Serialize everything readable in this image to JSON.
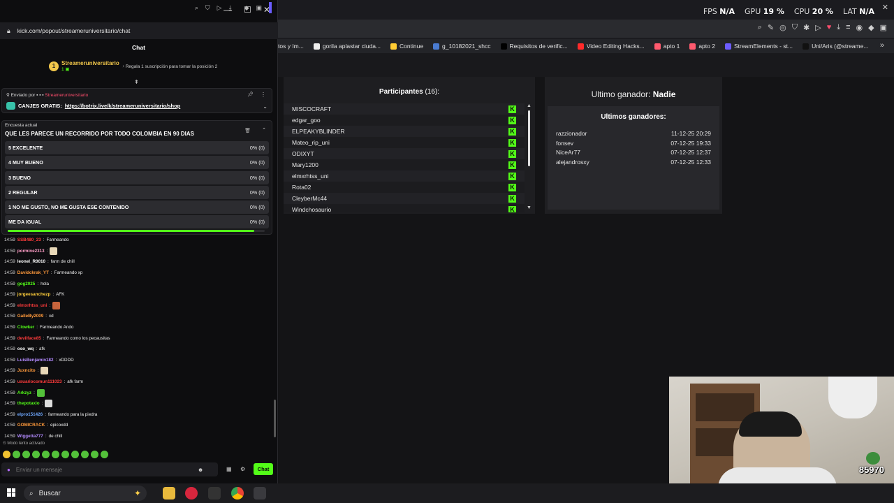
{
  "stats": {
    "fps_label": "FPS",
    "fps_value": "N/A",
    "gpu_label": "GPU",
    "gpu_value": "19 %",
    "cpu_label": "CPU",
    "cpu_value": "20 %",
    "lat_label": "LAT",
    "lat_value": "N/A"
  },
  "bookmarks": [
    {
      "label": "tos y Im...",
      "color": "#444444"
    },
    {
      "label": "gorila aplastar ciuda...",
      "color": "#eeeeee"
    },
    {
      "label": "Continue",
      "color": "#ffcc33"
    },
    {
      "label": "g_10182021_shcc",
      "color": "#4a7bd0"
    },
    {
      "label": "Requisitos de verific...",
      "color": "#000000"
    },
    {
      "label": "Video Editing Hacks...",
      "color": "#ff2a2a"
    },
    {
      "label": "apto 1",
      "color": "#ff5a6e"
    },
    {
      "label": "apto 2",
      "color": "#ff5a6e"
    },
    {
      "label": "StreamElements - st...",
      "color": "#6c5cff"
    },
    {
      "label": "Uni/Aris (@streame...",
      "color": "#111111"
    }
  ],
  "participants": {
    "title": "Participantes",
    "count": "(16):",
    "names": [
      "MISCOCRAFT",
      "edgar_goo",
      "ELPEAKYBLINDER",
      "Mateo_rip_uni",
      "ODIXYT",
      "Mary1200",
      "elmxrhtss_uni",
      "Rota02",
      "CleyberMc44",
      "Windchosaurio"
    ],
    "badge": "K"
  },
  "winner": {
    "label": "Ultimo ganador:",
    "name": "Nadie",
    "list_title": "Ultimos ganadores:",
    "list": [
      {
        "name": "razzionador",
        "date": "11-12-25 20:29"
      },
      {
        "name": "fonsev",
        "date": "07-12-25 19:33"
      },
      {
        "name": "NiceAr77",
        "date": "07-12-25 12:37"
      },
      {
        "name": "alejandrosxy",
        "date": "07-12-25 12:33"
      }
    ]
  },
  "webcam": {
    "counter": "85970"
  },
  "chat_window": {
    "url": "kick.com/popout/streameruniversitario/chat",
    "heading": "Chat",
    "top_gifter": {
      "rank": "1",
      "name": "Streameruniversitario",
      "count": "1"
    },
    "gift_tip": "Regala 1 suscripción para tomar la posición 2",
    "pinned": {
      "by_label": "Enviado por",
      "by_name": "Streameruniversitario",
      "text": "CANJES GRATIS:",
      "link": "https://botrix.live/k/streameruniversitario/shop"
    },
    "poll": {
      "kicker": "Encuesta actual",
      "question": "QUE LES PARECE UN RECORRIDO POR TODO COLOMBIA EN 90 DIAS",
      "options": [
        {
          "label": "5 EXCELENTE",
          "result": "0% (0)"
        },
        {
          "label": "4 MUY BUENO",
          "result": "0% (0)"
        },
        {
          "label": "3 BUENO",
          "result": "0% (0)"
        },
        {
          "label": "2 REGULAR",
          "result": "0% (0)"
        },
        {
          "label": "1 NO ME GUSTO, NO ME GUSTA ESE CONTENIDO",
          "result": "0% (0)"
        },
        {
          "label": "ME DA IGUAL",
          "result": "0% (0)"
        }
      ],
      "time_remaining_fraction": 0.96
    },
    "messages": [
      {
        "time": "14:59",
        "user": "SSB480_23",
        "color": "#ff3b3b",
        "text": "Farmeando"
      },
      {
        "time": "14:59",
        "user": "pormine2313",
        "color": "#ff9ec7",
        "text": "",
        "emote": "#e8d8b8"
      },
      {
        "time": "14:59",
        "user": "leonel_R0010",
        "color": "#ffffff",
        "text": "farm de chill"
      },
      {
        "time": "14:59",
        "user": "Davidckrak_YT",
        "color": "#ff9a3c",
        "text": "Farmeando xp"
      },
      {
        "time": "14:59",
        "user": "gog2025",
        "color": "#53fc18",
        "text": "hola"
      },
      {
        "time": "14:59",
        "user": "jorgeesanchezp",
        "color": "#ffcf3c",
        "text": "AFK"
      },
      {
        "time": "14:59",
        "user": "elmxrhtss_uni",
        "color": "#ff3b3b",
        "text": "",
        "emote": "#c8643c"
      },
      {
        "time": "14:59",
        "user": "GalleBy2009",
        "color": "#ff9a3c",
        "text": "xd"
      },
      {
        "time": "14:59",
        "user": "Clowker",
        "color": "#53fc18",
        "text": "Farmeando Ando"
      },
      {
        "time": "14:59",
        "user": "devilface85",
        "color": "#ff3b3b",
        "text": "Farmeando como los pecausitas"
      },
      {
        "time": "14:59",
        "user": "oso_wq",
        "color": "#ffffff",
        "text": "afk"
      },
      {
        "time": "14:59",
        "user": "LuisBenjamin182",
        "color": "#b38bff",
        "text": "xDDDD"
      },
      {
        "time": "14:59",
        "user": "Juxncito",
        "color": "#ff9a3c",
        "text": "",
        "emote": "#e8d8b8"
      },
      {
        "time": "14:59",
        "user": "usuariocomun111023",
        "color": "#ff3b3b",
        "text": "afk farm"
      },
      {
        "time": "14:59",
        "user": "Arkzyz",
        "color": "#53fc18",
        "text": "",
        "emote": "#53c13a"
      },
      {
        "time": "14:59",
        "user": "thepotaxio",
        "color": "#53fc18",
        "text": "",
        "emote": "#dddddd"
      },
      {
        "time": "14:59",
        "user": "elpro151426",
        "color": "#6fa8ff",
        "text": "farmeando para la piedra"
      },
      {
        "time": "14:59",
        "user": "GOMICRACK",
        "color": "#ff9a3c",
        "text": "epicoxdd"
      },
      {
        "time": "14:59",
        "user": "Wiggetta777",
        "color": "#b38bff",
        "text": "de chill"
      }
    ],
    "slow_mode": "Modo lento activado",
    "input_placeholder": "Enviar un mensaje",
    "send_label": "Chat"
  },
  "taskbar": {
    "search_label": "Buscar"
  }
}
